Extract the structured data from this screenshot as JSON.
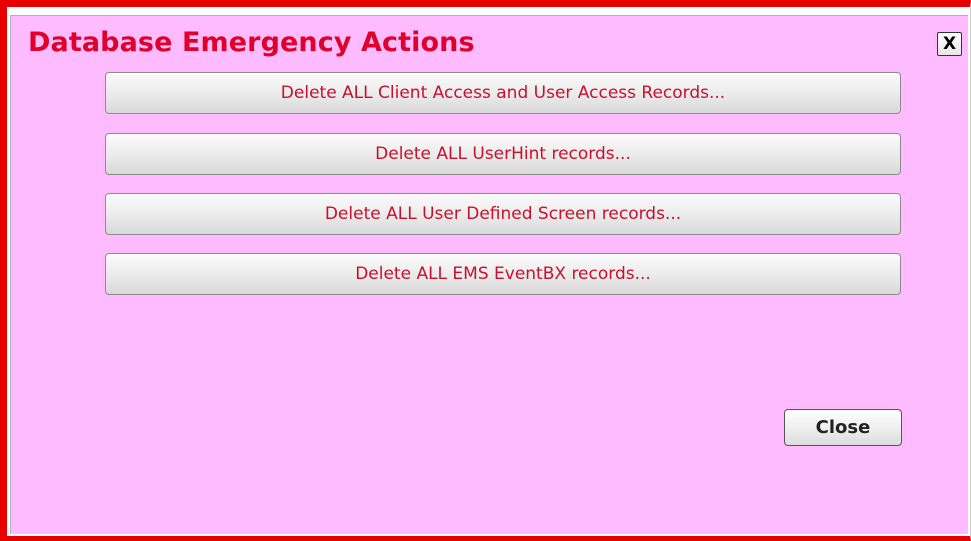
{
  "dialog": {
    "title": "Database Emergency Actions",
    "close_x_label": "X",
    "actions": [
      {
        "label": "Delete ALL Client Access and User Access Records..."
      },
      {
        "label": "Delete ALL UserHint records..."
      },
      {
        "label": "Delete ALL User Defined Screen records..."
      },
      {
        "label": "Delete ALL EMS EventBX records..."
      }
    ],
    "close_label": "Close"
  },
  "colors": {
    "frame_border": "#e60000",
    "background": "#ffbbff",
    "title": "#e0002a",
    "action_text": "#c8102e"
  }
}
